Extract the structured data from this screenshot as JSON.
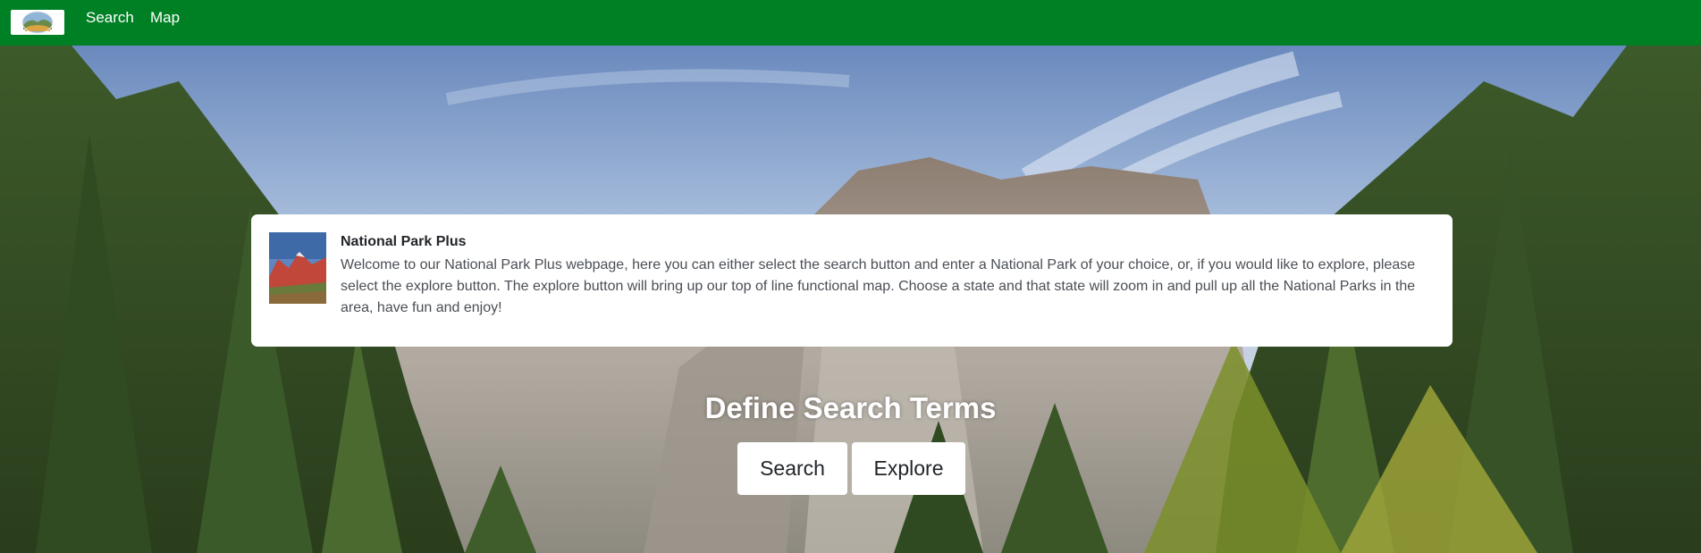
{
  "navbar": {
    "logo_icon": "park-landscape-logo-icon",
    "links": [
      {
        "label": "Search"
      },
      {
        "label": "Map"
      }
    ],
    "background": "#008024"
  },
  "card": {
    "title": "National Park Plus",
    "body": "Welcome to our National Park Plus webpage, here you can either select the search button and enter a National Park of your choice, or, if you would like to explore, please select the explore button. The explore button will bring up our top of line functional map. Choose a state and that state will zoom in and pull up all the National Parks in the area, have fun and enjoy!",
    "thumbnail_icon": "red-rock-mountain-thumbnail-icon"
  },
  "search_section": {
    "heading": "Define Search Terms",
    "search_button": "Search",
    "explore_button": "Explore"
  }
}
